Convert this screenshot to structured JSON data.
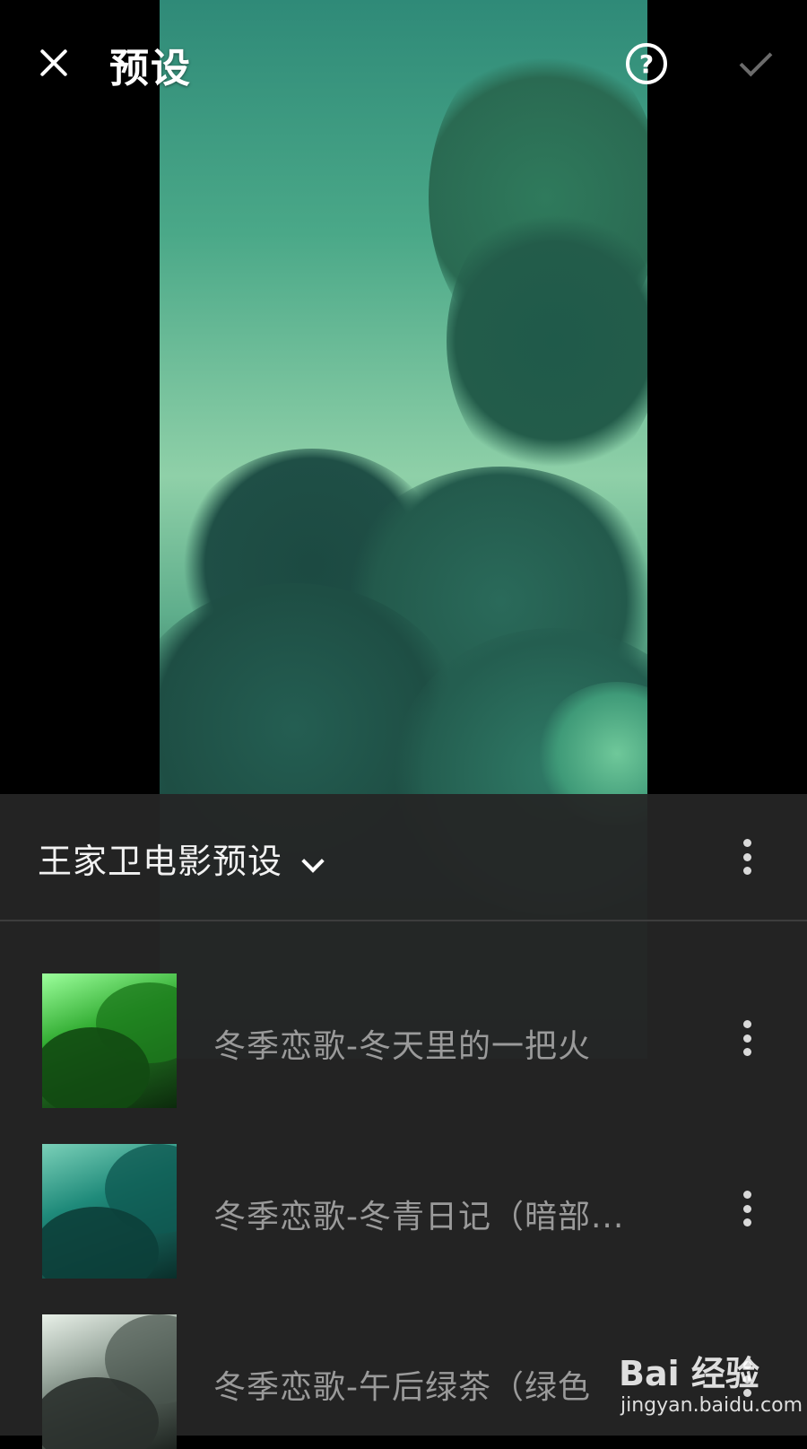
{
  "header": {
    "title": "预设"
  },
  "panel": {
    "folder_title": "王家卫电影预设"
  },
  "presets": [
    {
      "label": "冬季恋歌-冬天里的一把火",
      "thumb_color": "#2faa2f"
    },
    {
      "label": "冬季恋歌-冬青日记（暗部...",
      "thumb_color": "#1f8a7a"
    },
    {
      "label": "冬季恋歌-午后绿茶（绿色",
      "thumb_color": "#7a8a80"
    }
  ],
  "watermark": {
    "brand": "Bai 经验",
    "url": "jingyan.baidu.com"
  },
  "colors": {
    "panel_bg": "#252525",
    "label_text": "#9a9a9a",
    "accent_green": "#2faa2f"
  }
}
